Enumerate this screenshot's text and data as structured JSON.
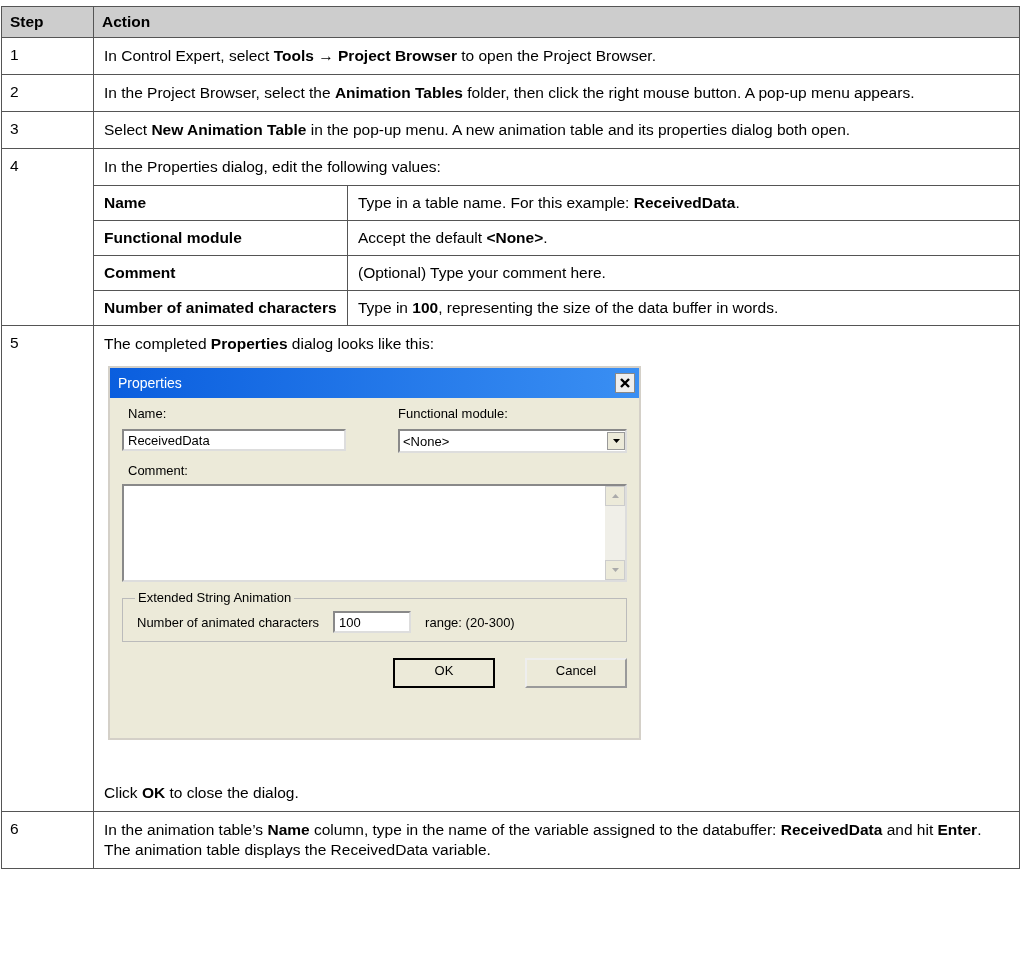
{
  "table": {
    "columns": [
      "Step",
      "Action"
    ],
    "rows": [
      {
        "step": "1",
        "blocks": [
          {
            "kind": "text",
            "text": "In Control Expert, select **Tools** → **Project Browser** to open the Project Browser."
          }
        ]
      },
      {
        "step": "2",
        "blocks": [
          {
            "kind": "text",
            "text": "In the Project Browser, select the **Animation Tables** folder, then click the right mouse button. A pop-up menu appears."
          }
        ]
      },
      {
        "step": "3",
        "blocks": [
          {
            "kind": "text",
            "text": "Select **New Animation Table** in the pop-up menu. A new animation table and its properties dialog both open."
          }
        ]
      },
      {
        "step": "4",
        "blocks": [
          {
            "kind": "text",
            "text": "In the Properties dialog, edit the following values:"
          },
          {
            "kind": "subtable",
            "rows": [
              {
                "field": "Name",
                "description": "Type in a table name. For this example: **ReceivedData**."
              },
              {
                "field": "Functional module",
                "description": "Accept the default **<None>**."
              },
              {
                "field": "Comment",
                "description": "(Optional) Type your comment here."
              },
              {
                "field": "Number of animated characters",
                "description": "Type in **100**, representing the size of the data buffer in words."
              }
            ]
          }
        ]
      },
      {
        "step": "5",
        "blocks": [
          {
            "kind": "text",
            "text": "The completed **Properties** dialog looks like this:"
          },
          {
            "kind": "dialog",
            "title": "Properties",
            "name_label": "Name:",
            "name_value": "ReceivedData",
            "module_label": "Functional module:",
            "module_value": "<None>",
            "comment_label": "Comment:",
            "group_title": "Extended String Animation",
            "chars_label": "Number of animated characters",
            "chars_value": "100",
            "range_label": "range: (20-300)",
            "buttons": [
              {
                "label": "OK",
                "default": true
              },
              {
                "label": "Cancel",
                "default": false
              }
            ]
          },
          {
            "kind": "text",
            "text": "Click **OK** to close the dialog."
          }
        ]
      },
      {
        "step": "6",
        "blocks": [
          {
            "kind": "text",
            "text": "In the animation table’s **Name** column, type in the name of the variable assigned to the databuffer: **ReceivedData** and hit **Enter**. The animation table displays the ReceivedData variable."
          }
        ]
      }
    ]
  }
}
